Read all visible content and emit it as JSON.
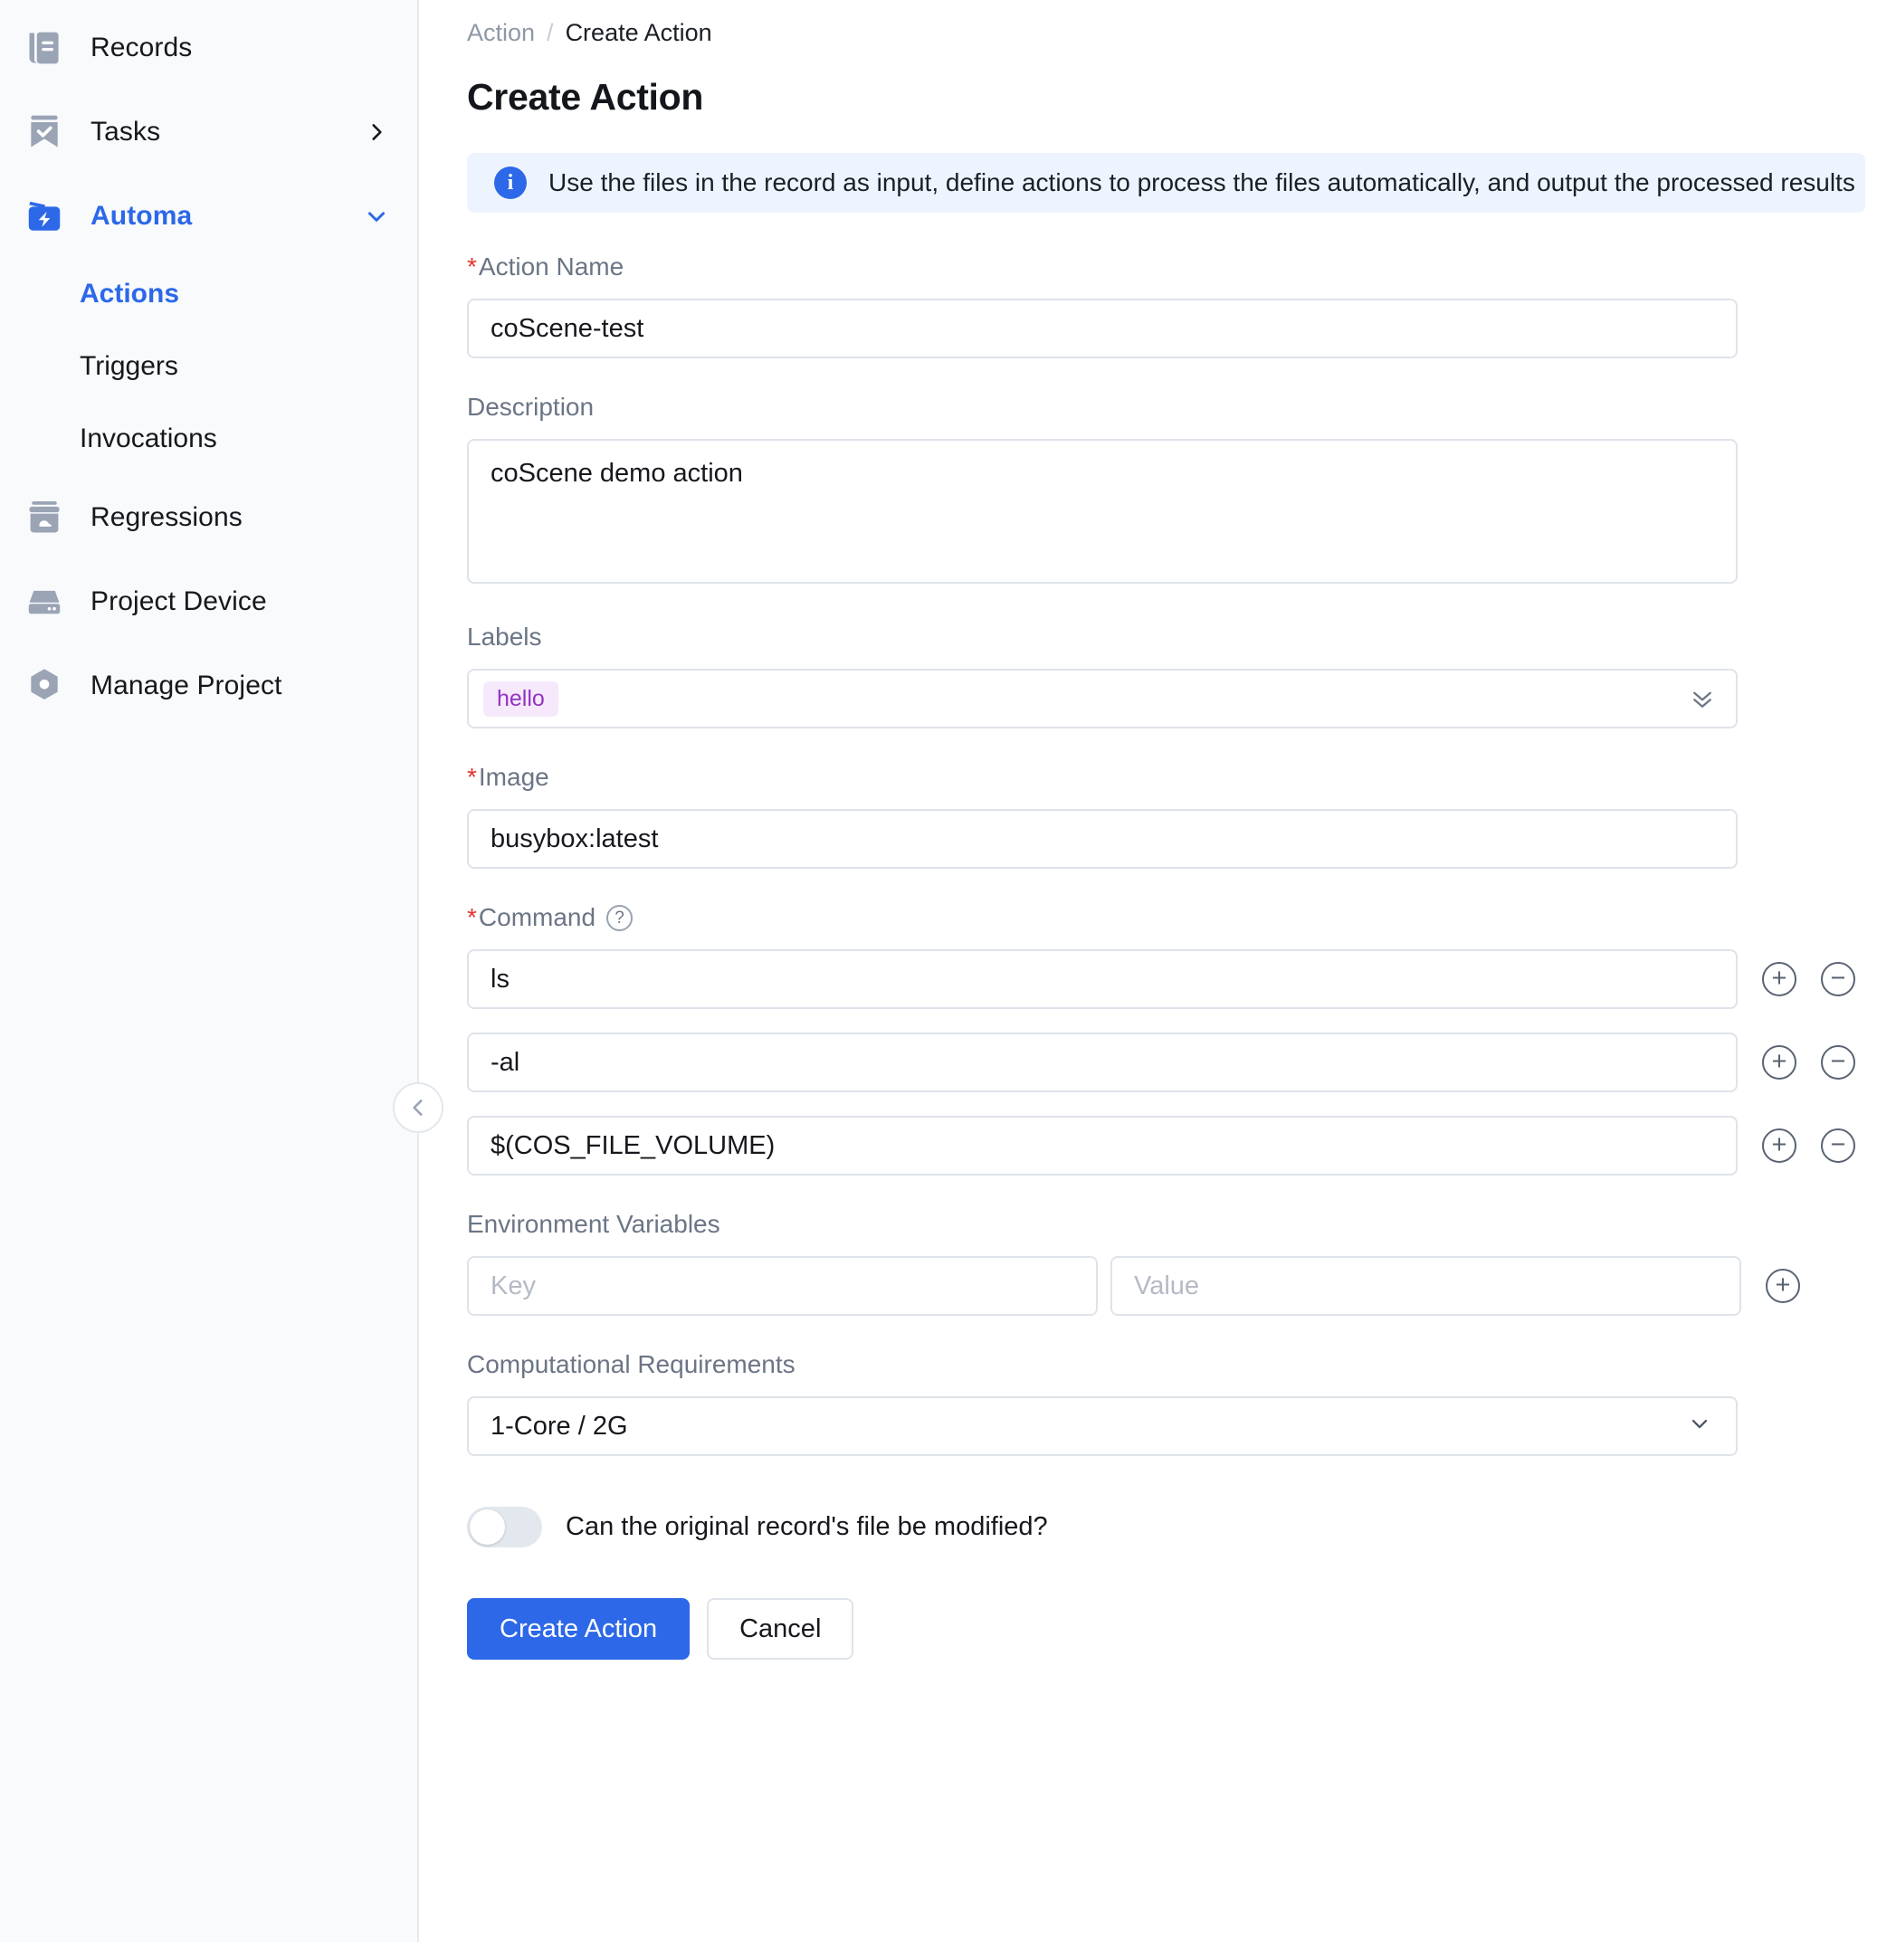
{
  "sidebar": {
    "items": [
      {
        "label": "Records",
        "icon": "records-icon",
        "has_caret": false,
        "active": false
      },
      {
        "label": "Tasks",
        "icon": "tasks-icon",
        "has_caret": true,
        "caret": "right",
        "active": false
      },
      {
        "label": "Automa",
        "icon": "automa-icon",
        "has_caret": true,
        "caret": "down",
        "active": true
      }
    ],
    "sub_items": [
      {
        "label": "Actions",
        "active": true
      },
      {
        "label": "Triggers",
        "active": false
      },
      {
        "label": "Invocations",
        "active": false
      }
    ],
    "items_bottom": [
      {
        "label": "Regressions",
        "icon": "regressions-icon"
      },
      {
        "label": "Project Device",
        "icon": "device-icon"
      },
      {
        "label": "Manage Project",
        "icon": "settings-hex-icon"
      }
    ]
  },
  "breadcrumb": {
    "parent": "Action",
    "separator": "/",
    "current": "Create Action"
  },
  "page": {
    "title": "Create Action"
  },
  "banner": {
    "icon": "info-icon",
    "text": "Use the files in the record as input, define actions to process the files automatically, and output the processed results"
  },
  "form": {
    "action_name": {
      "label": "Action Name",
      "required": true,
      "value": "coScene-test",
      "placeholder": ""
    },
    "description": {
      "label": "Description",
      "required": false,
      "value": "coScene demo action",
      "placeholder": ""
    },
    "labels": {
      "label": "Labels",
      "required": false,
      "tags": [
        "hello"
      ],
      "chevron": "double-chevron-down-icon"
    },
    "image": {
      "label": "Image",
      "required": true,
      "value": "busybox:latest",
      "placeholder": ""
    },
    "command": {
      "label": "Command",
      "required": true,
      "help_icon": "question-circle-icon",
      "rows": [
        {
          "value": "ls"
        },
        {
          "value": "-al"
        },
        {
          "value": "$(COS_FILE_VOLUME)"
        }
      ],
      "add_label": "+",
      "remove_label": "−"
    },
    "environment_variables": {
      "label": "Environment Variables",
      "key_placeholder": "Key",
      "value_placeholder": "Value",
      "key_value": "",
      "value_value": "",
      "add_label": "+"
    },
    "computational_requirements": {
      "label": "Computational Requirements",
      "selected": "1-Core / 2G",
      "caret": "chevron-down-icon"
    },
    "modify_toggle": {
      "label": "Can the original record's file be modified?",
      "enabled": false
    }
  },
  "actions": {
    "submit_label": "Create Action",
    "cancel_label": "Cancel"
  },
  "colors": {
    "accent": "#2c68e8",
    "banner_bg": "#eef4ff",
    "tag_bg": "#f6e9fb",
    "tag_fg": "#9333c4",
    "required_star": "#e0342c",
    "sidebar_bg": "#f8fafc"
  }
}
